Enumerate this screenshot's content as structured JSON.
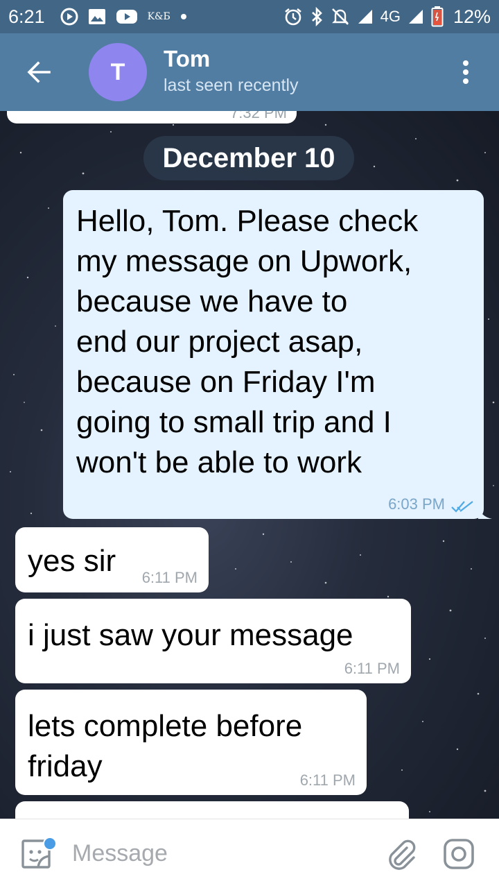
{
  "status_bar": {
    "time": "6:21",
    "left_icons": [
      "play-circle-icon",
      "image-icon",
      "youtube-icon",
      "kb-icon",
      "dot-icon"
    ],
    "kb_label": "K&Б",
    "network": "4G",
    "battery": "12%",
    "battery_color": "#e8533c"
  },
  "header": {
    "contact_name": "Tom",
    "avatar_letter": "T",
    "avatar_color": "#8e85ee",
    "status": "last seen recently",
    "bar_color": "#527da3"
  },
  "chat": {
    "previous_time": "7:32 PM",
    "date_separator": "December 10",
    "messages": [
      {
        "direction": "outgoing",
        "text": "Hello, Tom. Please check\nmy message on Upwork,\nbecause we have to\nend our project asap,\nbecause on Friday I'm\ngoing to small trip and I\nwon't be able to work",
        "time": "6:03 PM",
        "status": "read"
      },
      {
        "direction": "incoming",
        "text": "yes sir",
        "time": "6:11 PM"
      },
      {
        "direction": "incoming",
        "text": "i just saw your message",
        "time": "6:11 PM"
      },
      {
        "direction": "incoming",
        "text": "lets complete before\nfriday",
        "time": "6:11 PM"
      }
    ]
  },
  "input": {
    "placeholder": "Message"
  },
  "colors": {
    "outgoing_bubble": "#e5f2ff",
    "incoming_bubble": "#ffffff",
    "read_ticks": "#4fa9e3"
  }
}
